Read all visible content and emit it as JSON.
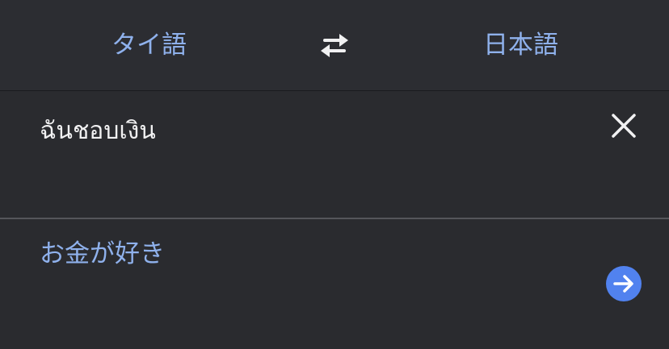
{
  "language_bar": {
    "source_language": "タイ語",
    "target_language": "日本語",
    "swap_icon": "swap-arrows-icon"
  },
  "input": {
    "text": "ฉันชอบเงิน",
    "clear_icon": "close-icon"
  },
  "output": {
    "text": "お金が好き",
    "go_icon": "arrow-right-circle-icon"
  },
  "colors": {
    "background": "#2a2b2f",
    "language_bar": "#2c2d32",
    "accent_text": "#8fb1ec",
    "primary_text": "#f1f1f2",
    "go_button": "#5182ef",
    "divider": "#55565b"
  }
}
